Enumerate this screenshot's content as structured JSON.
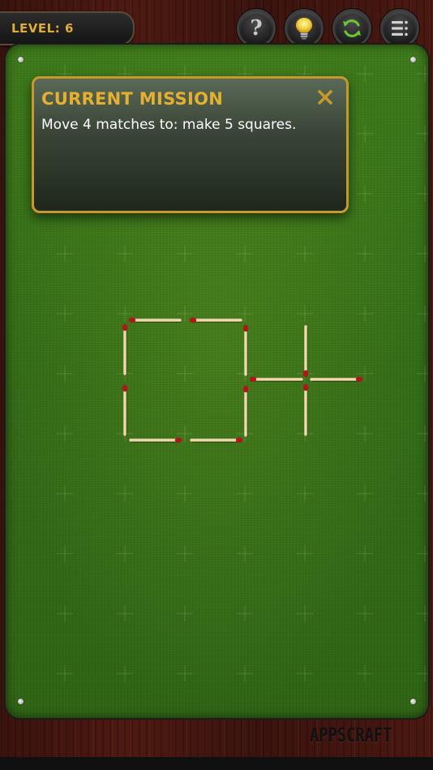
{
  "header": {
    "level_label": "LEVEL: 6"
  },
  "toolbar": {
    "buttons": [
      {
        "name": "help",
        "icon": "question-mark-icon",
        "glyph": "?"
      },
      {
        "name": "hint",
        "icon": "lightbulb-icon"
      },
      {
        "name": "restart",
        "icon": "refresh-icon"
      },
      {
        "name": "menu",
        "icon": "menu-list-icon"
      }
    ]
  },
  "mission": {
    "title": "CURRENT MISSION",
    "text": "Move 4 matches to: make 5 squares.",
    "close_icon": "close-icon"
  },
  "puzzle": {
    "match_count": 12,
    "colors": {
      "stick": "#f3d8ac",
      "head": "#b3151a"
    }
  },
  "footer": {
    "brand": "APPSCRAFT"
  },
  "colors": {
    "accent": "#e1ad2f",
    "felt": "#336b16",
    "wood": "#4a1811"
  }
}
